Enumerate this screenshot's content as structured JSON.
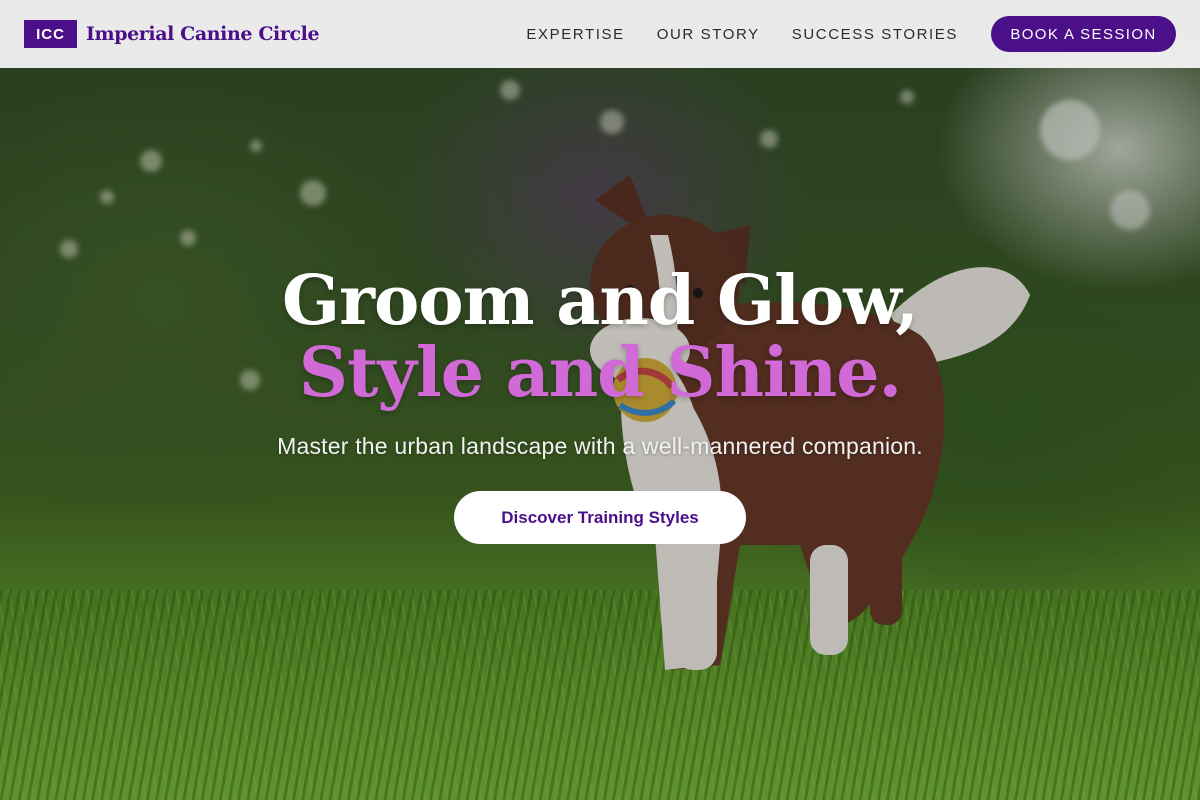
{
  "brand": {
    "badge": "ICC",
    "name": "Imperial Canine Circle"
  },
  "nav": {
    "links": [
      "EXPERTISE",
      "OUR STORY",
      "SUCCESS STORIES"
    ],
    "cta": "BOOK A SESSION"
  },
  "hero": {
    "headline_line1": "Groom and Glow,",
    "headline_line2": "Style and Shine.",
    "subheading": "Master the urban landscape with a well-mannered companion.",
    "cta": "Discover Training Styles"
  },
  "colors": {
    "brand_purple": "#4b0f8a",
    "accent_pink": "#d16ad6",
    "nav_bg": "#f5f5f5"
  },
  "icons": {
    "hero_image": "dog-photo"
  }
}
